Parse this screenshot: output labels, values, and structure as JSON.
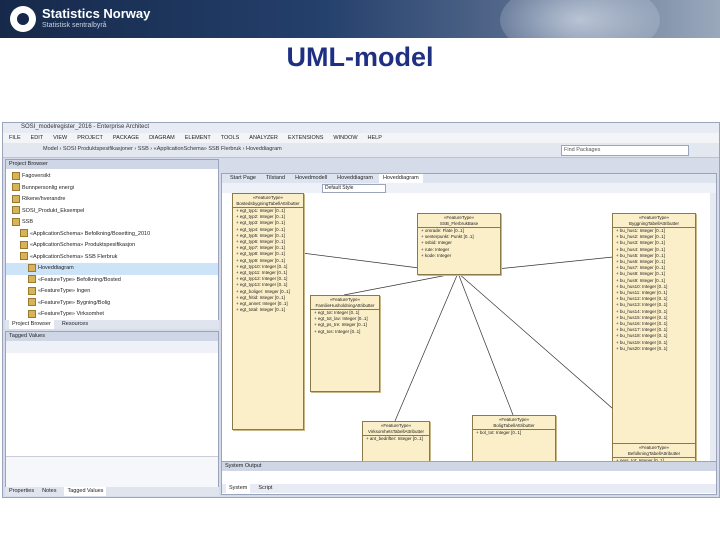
{
  "slide": {
    "logo_name": "Statistics Norway",
    "logo_sub": "Statistisk sentralbyrå",
    "title": "UML-model"
  },
  "app": {
    "window_title": "SOSI_modelregister_2016 - Enterprise Architect",
    "menu": [
      "FILE",
      "EDIT",
      "VIEW",
      "PROJECT",
      "PACKAGE",
      "DIAGRAM",
      "ELEMENT",
      "TOOLS",
      "ANALYZER",
      "EXTENSIONS",
      "WINDOW",
      "HELP"
    ],
    "breadcrumb": "Model › SOSI Produktspesifikasjoner › SSB › «ApplicationSchema» SSB Flerbruk › Hoveddiagram",
    "search_placeholder": "Find Packages"
  },
  "project_browser": {
    "title": "Project Browser",
    "items": [
      "Fagoversikt",
      "Bunnpersonlig energi",
      "Rikene/hverandre",
      "SOSI_Produkt_Eksempel",
      "SSB",
      "«ApplicationSchema» Befolkning/Bosetting_2010",
      "«ApplicationSchema» Produktspesifikasjon",
      "«ApplicationSchema» SSB Flerbruk",
      "Hoveddiagram",
      "«FeatureType» Befolkning/Bosted",
      "«FeatureType» Ingen",
      "«FeatureType» Bygning/Bolig",
      "«FeatureType» Virksomhet"
    ],
    "tabs": [
      "Project Browser",
      "Resources"
    ]
  },
  "tagged_values": {
    "title": "Tagged Values",
    "tabs": [
      "Properties",
      "Notes",
      "Tagged Values"
    ]
  },
  "diagram": {
    "tabs": [
      "Start Page",
      "Tilstand",
      "Hovedmodell",
      "Hoveddiagram",
      "Hoveddiagram"
    ],
    "style": "Default Style",
    "classes": [
      {
        "stereo": "«FeatureType»",
        "name": "BostedsbygningTabellAttributter",
        "attrs": [
          "+ egt_typ1: Integer [0..1]",
          "+ egt_typ2: Integer [0..1]",
          "+ egt_typ3: Integer [0..1]",
          "+ egt_typ4: Integer [0..1]",
          "+ egt_typ5: Integer [0..1]",
          "+ egt_typ6: Integer [0..1]",
          "+ egt_typ7: Integer [0..1]",
          "+ egt_typ8: Integer [0..1]",
          "+ egt_typ9: Integer [0..1]",
          "+ egt_typ10: Integer [0..1]",
          "+ egt_typ11: Integer [0..1]",
          "+ egt_typ12: Integer [0..1]",
          "+ egt_typ13: Integer [0..1]",
          "+ egt_boliger: Integer [0..1]",
          "+ egt_fritid: Integer [0..1]",
          "+ egt_annet: Integer [0..1]",
          "+ egt_total: Integer [0..1]"
        ]
      },
      {
        "stereo": "«FeatureType»",
        "name": "SSB_FlerbrukBase",
        "attrs": [
          "+ omrade: Flate [0..1]",
          "+ senterpunkt: Punkt [0..1]",
          "+ ssbid: Integer",
          "+ rute: Integer",
          "+ kode: Integer"
        ]
      },
      {
        "stereo": "«FeatureType»",
        "name": "ByggningTabellAttributter",
        "attrs": [
          "+ bu_hus1: Integer [0..1]",
          "+ bu_hus2: Integer [0..1]",
          "+ bu_hus3: Integer [0..1]",
          "+ bu_hus4: Integer [0..1]",
          "+ bu_hus5: Integer [0..1]",
          "+ bu_hus6: Integer [0..1]",
          "+ bu_hus7: Integer [0..1]",
          "+ bu_hus8: Integer [0..1]",
          "+ bu_hus9: Integer [0..1]",
          "+ bu_hus10: Integer [0..1]",
          "+ bu_hus11: Integer [0..1]",
          "+ bu_hus12: Integer [0..1]",
          "+ bu_hus13: Integer [0..1]",
          "+ bu_hus14: Integer [0..1]",
          "+ bu_hus15: Integer [0..1]",
          "+ bu_hus16: Integer [0..1]",
          "+ bu_hus17: Integer [0..1]",
          "+ bu_hus18: Integer [0..1]",
          "+ bu_hus19: Integer [0..1]",
          "+ bu_hus20: Integer [0..1]"
        ]
      },
      {
        "stereo": "«FeatureType»",
        "name": "FamilieHusholdningAttributter",
        "attrs": [
          "+ egt_tot: Integer [0..1]",
          "+ egt_tot_lav: Integer [0..1]",
          "+ egt_ps_tre: Integer [0..1]",
          "+ egt_tos: Integer [0..1]"
        ]
      },
      {
        "stereo": "«FeatureType»",
        "name": "VirksomhetsTabellAttributter",
        "attrs": [
          "+ ant_bedrifter: Integer [0..1]"
        ]
      },
      {
        "stereo": "«FeatureType»",
        "name": "BoligTabellAttributter",
        "attrs": [
          "+ bol_tot: Integer [0..1]"
        ]
      },
      {
        "stereo": "«FeatureType»",
        "name": "BefolkningTabellAttributter",
        "attrs": [
          "+ pers_tot: Integer [0..1]"
        ]
      }
    ]
  },
  "system_output": {
    "title": "System Output",
    "tabs": [
      "System",
      "Script"
    ]
  }
}
